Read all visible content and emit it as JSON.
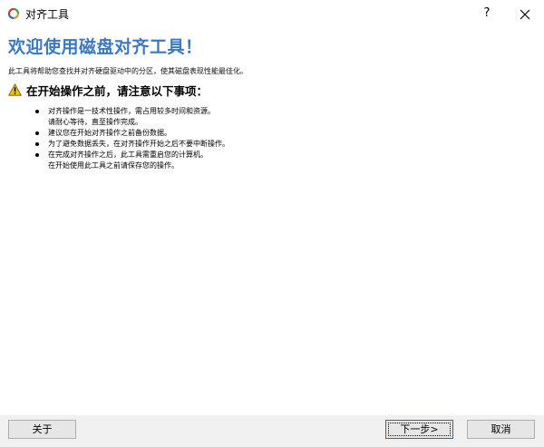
{
  "window": {
    "title": "对齐工具",
    "help_label": "?"
  },
  "main": {
    "heading": "欢迎使用磁盘对齐工具！",
    "intro": "此工具将帮助您查找并对齐硬盘驱动中的分区，使其磁盘表现性能最佳化。",
    "warning_title": "在开始操作之前，请注意以下事项：",
    "items": [
      {
        "lines": [
          "对齐操作是一技术性操作，需占用较多时间和资源。",
          "请耐心等待，直至操作完成。"
        ]
      },
      {
        "lines": [
          "建议您在开始对齐操作之前备份数据。"
        ]
      },
      {
        "lines": [
          "为了避免数据丢失，在对齐操作开始之后不要中断操作。"
        ]
      },
      {
        "lines": [
          "在完成对齐操作之后，此工具需重启您的计算机。",
          "在开始使用此工具之前请保存您的操作。"
        ]
      }
    ]
  },
  "footer": {
    "about_label": "关于",
    "next_label": "下一步>",
    "cancel_label": "取消"
  },
  "colors": {
    "heading": "#3b79c2",
    "warning_fill": "#f2c200",
    "focus_border": "#0078d7"
  },
  "icons": {
    "app": "recycle-app-icon",
    "warning": "warning-icon",
    "close": "close-icon"
  }
}
